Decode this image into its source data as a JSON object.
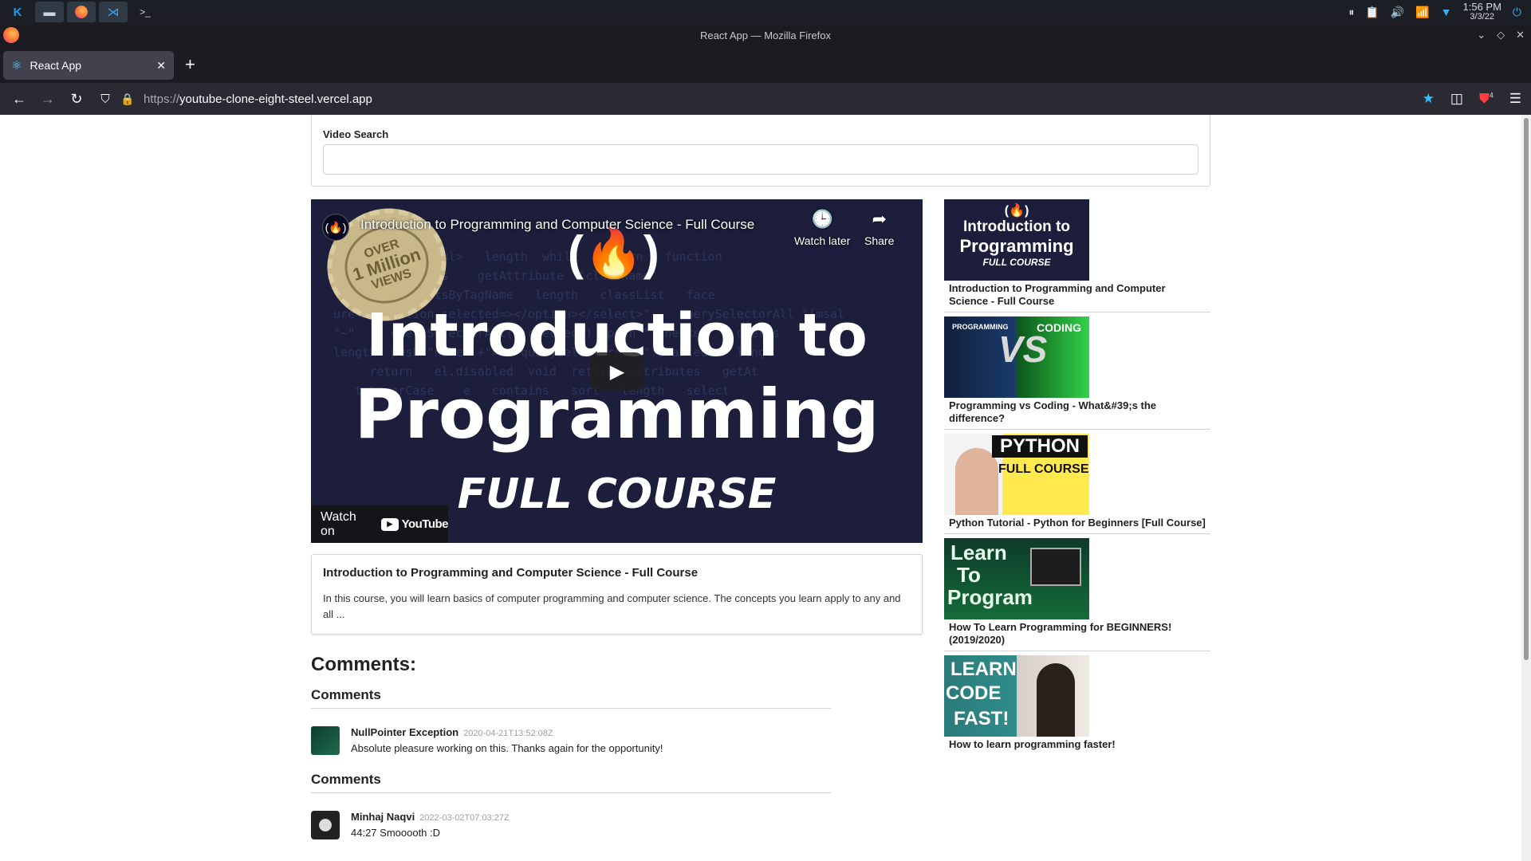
{
  "taskbar": {
    "clock_time": "1:56 PM",
    "clock_date": "3/3/22"
  },
  "window": {
    "title": "React App — Mozilla Firefox"
  },
  "tab": {
    "label": "React App"
  },
  "navbar": {
    "url_scheme": "https://",
    "url_host": "youtube-clone-eight-steel.vercel.app",
    "ublock_count": "4"
  },
  "search": {
    "label": "Video Search",
    "value": "",
    "placeholder": ""
  },
  "player": {
    "overlay_title": "Introduction to Programming and Computer Science - Full Course",
    "watch_later": "Watch later",
    "share": "Share",
    "watch_on": "Watch on",
    "youtube": "YouTube",
    "thumb_line1": "Introduction to",
    "thumb_line2": "Programming",
    "thumb_line3": "FULL COURSE",
    "badge_top": "OVER",
    "badge_mid": "1 Million",
    "badge_bottom": "VIEWS"
  },
  "description": {
    "title": "Introduction to Programming and Computer Science - Full Course",
    "text": "In this course, you will learn basics of computer programming and computer science. The concepts you learn apply to any and all ..."
  },
  "comments": {
    "heading": "Comments:",
    "sections": [
      {
        "header": "Comments",
        "author": "NullPointer Exception",
        "date": "2020-04-21T13:52:08Z",
        "text": "Absolute pleasure working on this. Thanks again for the opportunity!"
      },
      {
        "header": "Comments",
        "author": "Minhaj Naqvi",
        "date": "2022-03-02T07:03:27Z",
        "text": "44:27 Smooooth :D"
      }
    ]
  },
  "sidebar": {
    "videos": [
      {
        "title": "Introduction to Programming and Computer Science - Full Course",
        "thumb_a": "Introduction to",
        "thumb_b": "Programming",
        "thumb_c": "FULL COURSE"
      },
      {
        "title": "Programming vs Coding - What&#39;s the difference?",
        "thumb_a": "PROGRAMMING",
        "thumb_b": "VS",
        "thumb_c": "CODING"
      },
      {
        "title": "Python Tutorial - Python for Beginners [Full Course]",
        "thumb_a": "PYTHON",
        "thumb_b": "FULL COURSE"
      },
      {
        "title": "How To Learn Programming for BEGINNERS! (2019/2020)",
        "thumb_a": "Learn",
        "thumb_b": "To",
        "thumb_c": "Program"
      },
      {
        "title": "How to learn programming faster!",
        "thumb_a": "LEARN",
        "thumb_b": "CODE",
        "thumb_c": "FAST!"
      }
    ]
  },
  "colors": {
    "accent_star": "#2ac3ff",
    "player_bg": "#1c1e3b",
    "python_yellow": "#ffe94d"
  },
  "icons": [
    "kde-logo-icon",
    "files-icon",
    "firefox-icon",
    "vscode-icon",
    "terminal-icon",
    "pause-icon",
    "clipboard-icon",
    "volume-icon",
    "wifi-icon",
    "chevron-down-icon",
    "react-icon",
    "close-icon",
    "plus-icon",
    "back-icon",
    "forward-icon",
    "reload-icon",
    "shield-icon",
    "lock-icon",
    "star-icon",
    "pocket-icon",
    "ublock-icon",
    "menu-icon",
    "clock-icon",
    "share-icon",
    "play-icon"
  ]
}
